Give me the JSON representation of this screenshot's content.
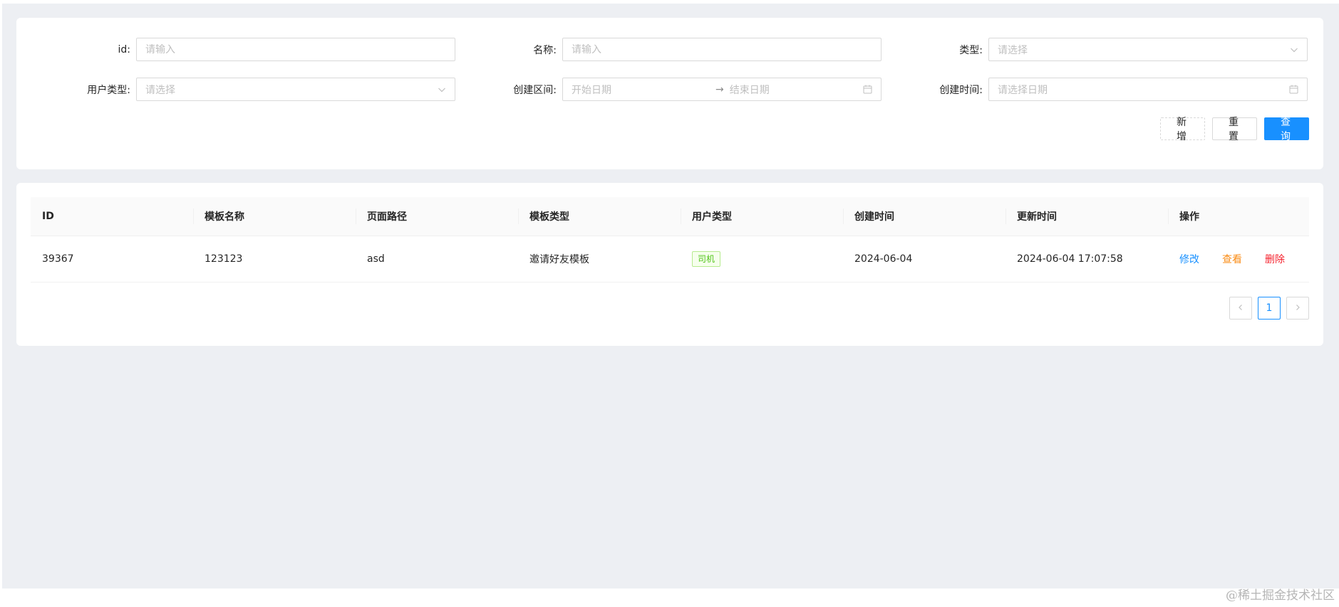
{
  "filter": {
    "id": {
      "label": "id:",
      "placeholder": "请输入"
    },
    "name": {
      "label": "名称:",
      "placeholder": "请输入"
    },
    "type": {
      "label": "类型:",
      "placeholder": "请选择"
    },
    "user_type": {
      "label": "用户类型:",
      "placeholder": "请选择"
    },
    "create_range": {
      "label": "创建区间:",
      "start_placeholder": "开始日期",
      "separator": "→",
      "end_placeholder": "结束日期"
    },
    "create_time": {
      "label": "创建时间:",
      "placeholder": "请选择日期"
    },
    "buttons": {
      "add": "新增",
      "reset": "重置",
      "search": "查询"
    }
  },
  "table": {
    "columns": [
      "ID",
      "模板名称",
      "页面路径",
      "模板类型",
      "用户类型",
      "创建时间",
      "更新时间",
      "操作"
    ],
    "rows": [
      {
        "id": "39367",
        "template_name": "123123",
        "page_path": "asd",
        "template_type": "邀请好友模板",
        "user_type": "司机",
        "created_at": "2024-06-04",
        "updated_at": "2024-06-04 17:07:58",
        "actions": {
          "edit": "修改",
          "view": "查看",
          "delete": "删除"
        }
      }
    ],
    "status_colors": {
      "tag_green": "#52c41a",
      "edit": "#1890ff",
      "view": "#fa8c16",
      "delete": "#f5222d"
    }
  },
  "pagination": {
    "current_page": "1",
    "prev_icon": "chevron-left-icon",
    "next_icon": "chevron-right-icon"
  },
  "watermark": "@稀土掘金技术社区",
  "theme": {
    "primary": "#1890ff",
    "background": "#edeff3"
  }
}
